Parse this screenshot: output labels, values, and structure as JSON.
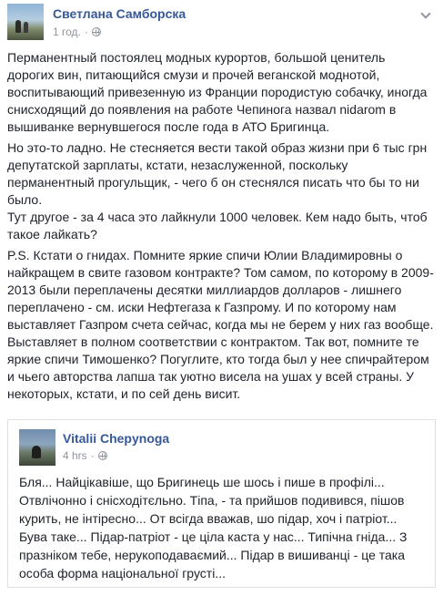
{
  "post": {
    "author": "Светлана Самборска",
    "time": "1 год.",
    "paragraphs": [
      "Перманентный постоялец модных курортов, большой ценитель дорогих вин, питающийся смузи и прочей веганской моднотой, воспитывающий привезенную из Франции породистую собачку, иногда снисходящий до появления на работе Чепинога назвал nidarom в вышиванке вернувшегося после года в АТО Бригинца.",
      "Но это-то ладно. Не стесняется вести такой образ жизни при 6 тыс грн депутатской зарплаты, кстати, незаслуженной, поскольку перманентный прогульщик, - чего б он стеснялся писать что бы то ни было.\nТут другое - за 4 часа это лайкнули 1000 человек. Кем надо быть, чтоб такое лайкать?",
      "P.S. Кстати о гнидах. Помните яркие спичи Юлии Владимировны о найкращем в свите газовом контракте? Том самом, по которому в 2009-2013 были переплачены десятки миллиардов долларов - лишнего переплачено - см. иски Нефтегаза к Газпрому. И по которому нам выставляет Газпром счета сейчас, когда мы не берем у них газ вообще. Выставляет в полном соответствии с контрактом. Так вот, помните те яркие спичи Тимошенко? Погуглите, кто тогда был у нее спичрайтером и чьего авторства лапша так уютно висела на ушах у всей страны. У некоторых, кстати, и по сей день висит."
    ]
  },
  "shared": {
    "author": "Vitalii Chepynoga",
    "time": "4 hrs",
    "text": "Бля... Найцікавіше, що Бригинець ше шось і пише в профілі... Отвлічонно і снісходітєльно. Тіпа, - та прийшов подивився, пішов курить, не інтіресно... От всігда вважав, шо підар, хоч і патріот... Бува таке... Підар-патріот - це ціла каста у нас... Типічна гніда... З празніком тебе, нерукоподаваємий... Підар в вишиванці - це така особа форма національної грусті..."
  }
}
